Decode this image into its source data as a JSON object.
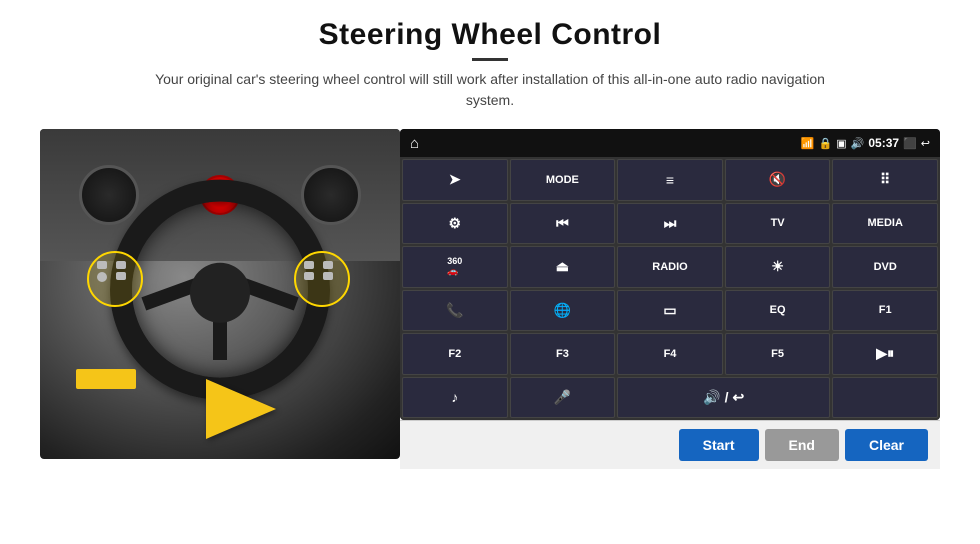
{
  "page": {
    "title": "Steering Wheel Control",
    "divider": "—",
    "subtitle": "Your original car's steering wheel control will still work after installation of this all-in-one auto radio navigation system."
  },
  "status_bar": {
    "home_icon": "⌂",
    "wifi_icon": "📶",
    "lock_icon": "🔒",
    "sim_icon": "📱",
    "bt_icon": "🔊",
    "time": "05:37",
    "screen_icon": "⬛",
    "back_icon": "↩"
  },
  "control_buttons": [
    {
      "id": "send",
      "label": "➤",
      "is_icon": true
    },
    {
      "id": "mode",
      "label": "MODE"
    },
    {
      "id": "list",
      "label": "≡",
      "is_icon": true
    },
    {
      "id": "vol_mute",
      "label": "🔇",
      "is_icon": true
    },
    {
      "id": "dots",
      "label": "⠿",
      "is_icon": true
    },
    {
      "id": "settings",
      "label": "⚙",
      "is_icon": true
    },
    {
      "id": "prev",
      "label": "⏮",
      "is_icon": true
    },
    {
      "id": "next",
      "label": "⏭",
      "is_icon": true
    },
    {
      "id": "tv",
      "label": "TV"
    },
    {
      "id": "media",
      "label": "MEDIA"
    },
    {
      "id": "camera360",
      "label": "360",
      "is_icon": false
    },
    {
      "id": "eject",
      "label": "⏏",
      "is_icon": true
    },
    {
      "id": "radio",
      "label": "RADIO"
    },
    {
      "id": "brightness",
      "label": "☀",
      "is_icon": true
    },
    {
      "id": "dvd",
      "label": "DVD"
    },
    {
      "id": "phone",
      "label": "📞",
      "is_icon": true
    },
    {
      "id": "internet",
      "label": "🌐",
      "is_icon": true
    },
    {
      "id": "screen",
      "label": "▭",
      "is_icon": true
    },
    {
      "id": "eq",
      "label": "EQ"
    },
    {
      "id": "f1",
      "label": "F1"
    },
    {
      "id": "f2",
      "label": "F2"
    },
    {
      "id": "f3",
      "label": "F3"
    },
    {
      "id": "f4",
      "label": "F4"
    },
    {
      "id": "f5",
      "label": "F5"
    },
    {
      "id": "playpause",
      "label": "▶⏸",
      "is_icon": true
    },
    {
      "id": "music",
      "label": "♪",
      "is_icon": true
    },
    {
      "id": "mic",
      "label": "🎤",
      "is_icon": true
    },
    {
      "id": "vol_phone",
      "label": "🔊/↩",
      "is_icon": true
    },
    {
      "id": "empty1",
      "label": ""
    },
    {
      "id": "empty2",
      "label": ""
    }
  ],
  "bottom_bar": {
    "start_label": "Start",
    "end_label": "End",
    "clear_label": "Clear"
  }
}
